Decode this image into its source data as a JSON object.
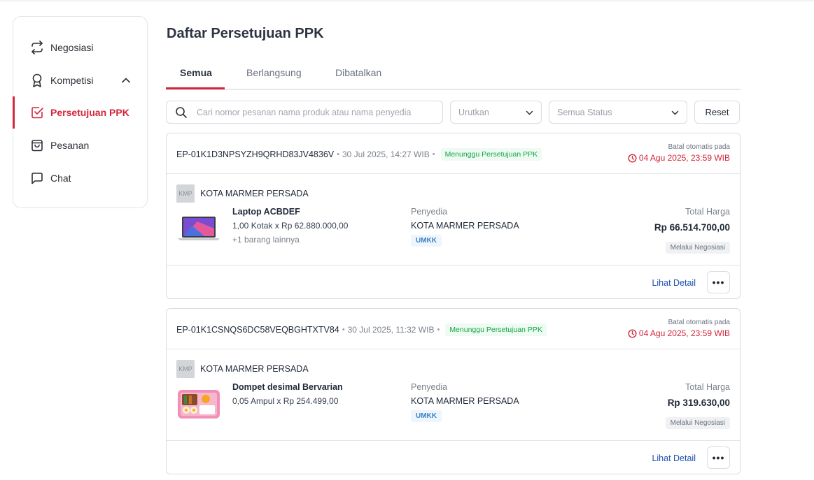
{
  "sidebar": {
    "items": [
      {
        "label": "Negosiasi",
        "icon": "arrows-swap-icon"
      },
      {
        "label": "Kompetisi",
        "icon": "award-icon"
      },
      {
        "label": "Persetujuan PPK",
        "icon": "checkbox-icon",
        "active": true
      },
      {
        "label": "Pesanan",
        "icon": "shopping-bag-icon"
      },
      {
        "label": "Chat",
        "icon": "chat-bubble-icon"
      }
    ]
  },
  "main": {
    "title": "Daftar Persetujuan PPK",
    "tabs": [
      "Semua",
      "Berlangsung",
      "Dibatalkan"
    ],
    "search": {
      "placeholder": "Cari nomor pesanan nama produk atau nama penyedia"
    },
    "sort": {
      "value": "Urutkan"
    },
    "status_filter": {
      "value": "Semua Status"
    },
    "reset_label": "Reset"
  },
  "orders": [
    {
      "id": "EP-01K1D3NPSYZH9QRHD83JV4836V",
      "date": "30 Jul 2025, 14:27 WIB",
      "status": "Menunggu Persetujuan PPK",
      "cancel_note": "Batal otomatis pada",
      "deadline": "04 Agu 2025, 23:59 WIB",
      "vendor_logo": "KMP",
      "vendor": "KOTA MARMER PERSADA",
      "product_name": "Laptop ACBDEF",
      "product_qty": "1,00 Kotak x Rp 62.880.000,00",
      "product_more": "+1 barang lainnya",
      "provider_label": "Penyedia",
      "provider_name": "KOTA MARMER PERSADA",
      "provider_badge": "UMKK",
      "total_label": "Total Harga",
      "total_value": "Rp 66.514.700,00",
      "method": "Melalui Negosiasi",
      "detail_label": "Lihat Detail",
      "more_label": "•••"
    },
    {
      "id": "EP-01K1CSNQS6DC58VEQBGHTXTV84",
      "date": "30 Jul 2025, 11:32 WIB",
      "status": "Menunggu Persetujuan PPK",
      "cancel_note": "Batal otomatis pada",
      "deadline": "04 Agu 2025, 23:59 WIB",
      "vendor_logo": "KMP",
      "vendor": "KOTA MARMER PERSADA",
      "product_name": "Dompet desimal Bervarian",
      "product_qty": "0,05 Ampul x Rp 254.499,00",
      "provider_label": "Penyedia",
      "provider_name": "KOTA MARMER PERSADA",
      "provider_badge": "UMKK",
      "total_label": "Total Harga",
      "total_value": "Rp 319.630,00",
      "method": "Melalui Negosiasi",
      "detail_label": "Lihat Detail",
      "more_label": "•••"
    }
  ],
  "colors": {
    "accent": "#d1263b",
    "link": "#1e4fb3",
    "status_green": "#16a34a"
  }
}
